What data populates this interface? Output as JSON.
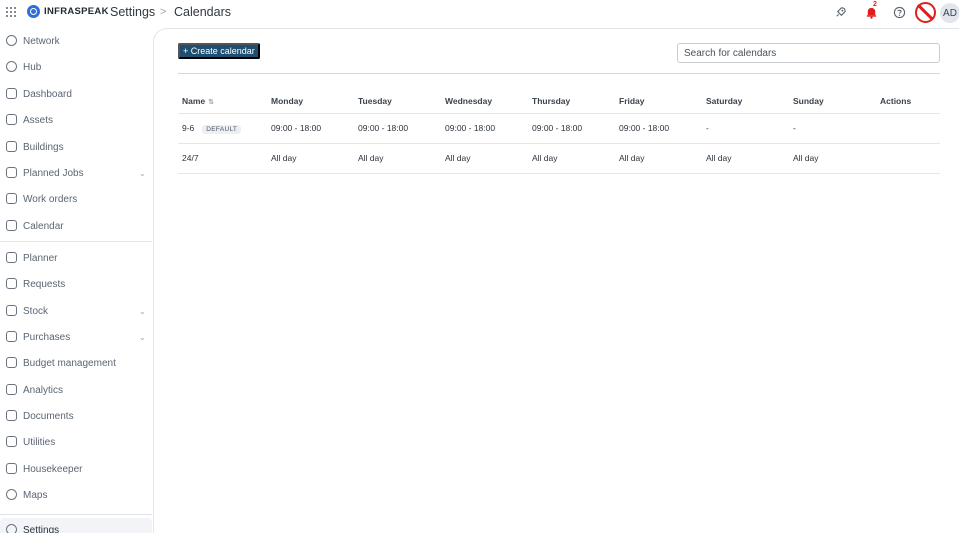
{
  "header": {
    "logo_text": "INFRASPEAK",
    "breadcrumb_parent": "Settings",
    "breadcrumb_separator": ">",
    "breadcrumb_current": "Calendars",
    "notification_count": "2",
    "avatar_initials": "AD",
    "icons": [
      "apps-grid-icon",
      "rocket-icon",
      "bell-icon",
      "help-icon",
      "blocked-icon"
    ],
    "accent_color": "#1d4f73",
    "alert_color": "#e11d1d"
  },
  "sidebar": {
    "items": [
      {
        "label": "Network",
        "icon": "network-icon",
        "expandable": false
      },
      {
        "label": "Hub",
        "icon": "hub-icon",
        "expandable": false
      },
      {
        "label": "Dashboard",
        "icon": "dashboard-icon",
        "expandable": false
      },
      {
        "label": "Assets",
        "icon": "assets-icon",
        "expandable": false
      },
      {
        "label": "Buildings",
        "icon": "buildings-icon",
        "expandable": false
      },
      {
        "label": "Planned Jobs",
        "icon": "planned-jobs-icon",
        "expandable": true
      },
      {
        "label": "Work orders",
        "icon": "work-orders-icon",
        "expandable": false
      },
      {
        "label": "Calendar",
        "icon": "calendar-icon",
        "expandable": false
      },
      {
        "label": "Planner",
        "icon": "planner-icon",
        "expandable": false
      },
      {
        "label": "Requests",
        "icon": "requests-icon",
        "expandable": false
      },
      {
        "label": "Stock",
        "icon": "stock-icon",
        "expandable": true
      },
      {
        "label": "Purchases",
        "icon": "cart-icon",
        "expandable": true
      },
      {
        "label": "Budget management",
        "icon": "budget-icon",
        "expandable": false
      },
      {
        "label": "Analytics",
        "icon": "analytics-icon",
        "expandable": false
      },
      {
        "label": "Documents",
        "icon": "documents-icon",
        "expandable": false
      },
      {
        "label": "Utilities",
        "icon": "utilities-icon",
        "expandable": false
      },
      {
        "label": "Housekeeper",
        "icon": "housekeeper-icon",
        "expandable": false
      },
      {
        "label": "Maps",
        "icon": "map-pin-icon",
        "expandable": false
      },
      {
        "label": "Settings",
        "icon": "settings-icon",
        "expandable": false,
        "active": true
      }
    ],
    "chevron": "⌄"
  },
  "main": {
    "create_button_label": "+ Create calendar",
    "search_placeholder": "Search for calendars",
    "table": {
      "columns": [
        "Name",
        "Monday",
        "Tuesday",
        "Wednesday",
        "Thursday",
        "Friday",
        "Saturday",
        "Sunday",
        "Actions"
      ],
      "sort_indicator": "⇅",
      "rows": [
        {
          "name": "9-6",
          "badge": "DEFAULT",
          "cells": [
            "09:00 - 18:00",
            "09:00 - 18:00",
            "09:00 - 18:00",
            "09:00 - 18:00",
            "09:00 - 18:00",
            "-",
            "-",
            ""
          ]
        },
        {
          "name": "24/7",
          "badge": "",
          "cells": [
            "All day",
            "All day",
            "All day",
            "All day",
            "All day",
            "All day",
            "All day",
            ""
          ]
        }
      ]
    }
  }
}
